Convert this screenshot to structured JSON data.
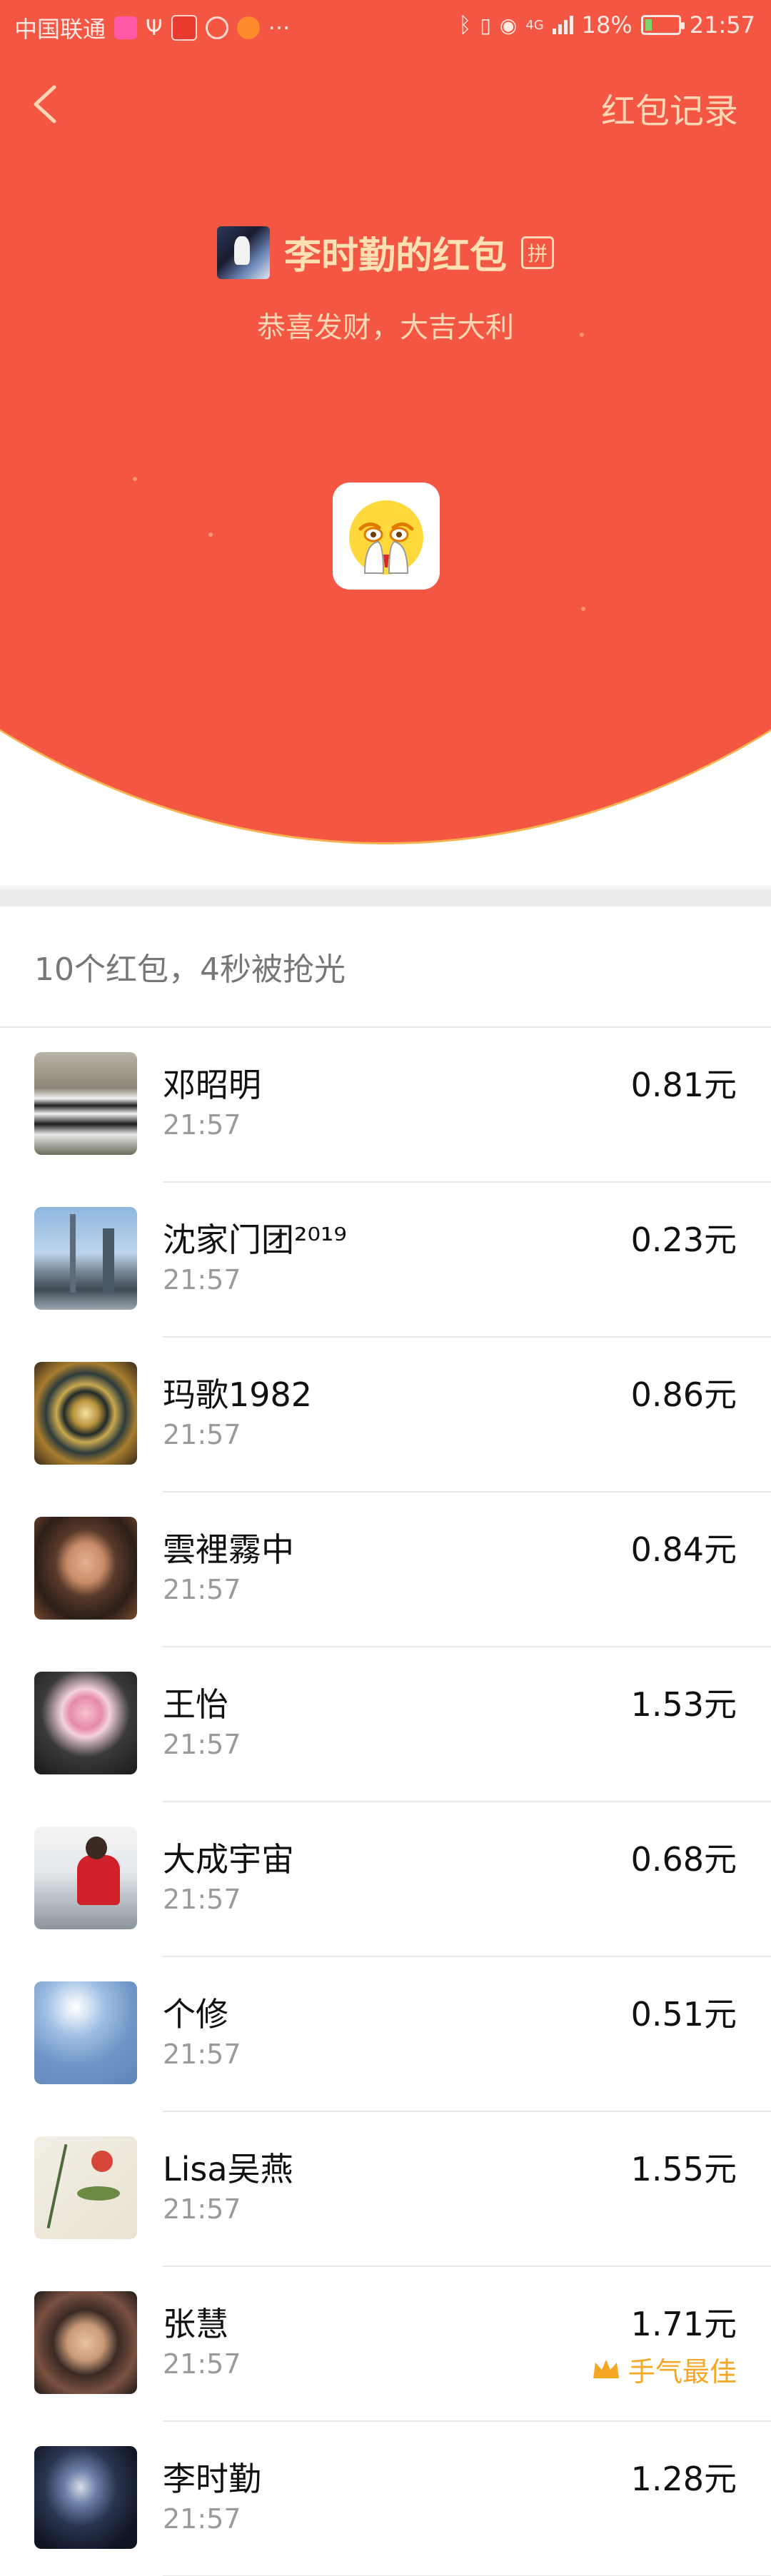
{
  "status_bar": {
    "carrier": "中国联通",
    "overflow": "···",
    "network": "4G",
    "battery": "18%",
    "battery_level": 0.18,
    "time": "21:57"
  },
  "header": {
    "back_icon": "chevron-left-icon",
    "record_label": "红包记录",
    "sender_name": "李时勤的红包",
    "badge_label": "拼",
    "greeting": "恭喜发财，大吉大利",
    "sticker_icon": "face-covering-emoji-icon"
  },
  "colors": {
    "header_red": "#f35643",
    "header_text": "#ffd7b4",
    "best_gold": "#f5a623"
  },
  "summary": "10个红包，4秒被抢光",
  "records": [
    {
      "name": "邓昭明",
      "time": "21:57",
      "amount": "0.81元",
      "avatar": "pandas-photo"
    },
    {
      "name": "沈家门团²⁰¹⁹",
      "time": "21:57",
      "amount": "0.23元",
      "avatar": "skyline-photo"
    },
    {
      "name": "玛歌1982",
      "time": "21:57",
      "amount": "0.86元",
      "avatar": "mandala-photo"
    },
    {
      "name": "雲裡霧中",
      "time": "21:57",
      "amount": "0.84元",
      "avatar": "portrait-photo"
    },
    {
      "name": "王怡",
      "time": "21:57",
      "amount": "1.53元",
      "avatar": "peony-photo"
    },
    {
      "name": "大成宇宙",
      "time": "21:57",
      "amount": "0.68元",
      "avatar": "seaside-photo"
    },
    {
      "name": "个修",
      "time": "21:57",
      "amount": "0.51元",
      "avatar": "sky-photo"
    },
    {
      "name": "Lisa吴燕",
      "time": "21:57",
      "amount": "1.55元",
      "avatar": "bamboo-painting"
    },
    {
      "name": "张慧",
      "time": "21:57",
      "amount": "1.71元",
      "avatar": "man-glasses-photo",
      "best_label": "手气最佳",
      "best_icon": "crown-icon"
    },
    {
      "name": "李时勤",
      "time": "21:57",
      "amount": "1.28元",
      "avatar": "dark-portrait-photo"
    }
  ]
}
